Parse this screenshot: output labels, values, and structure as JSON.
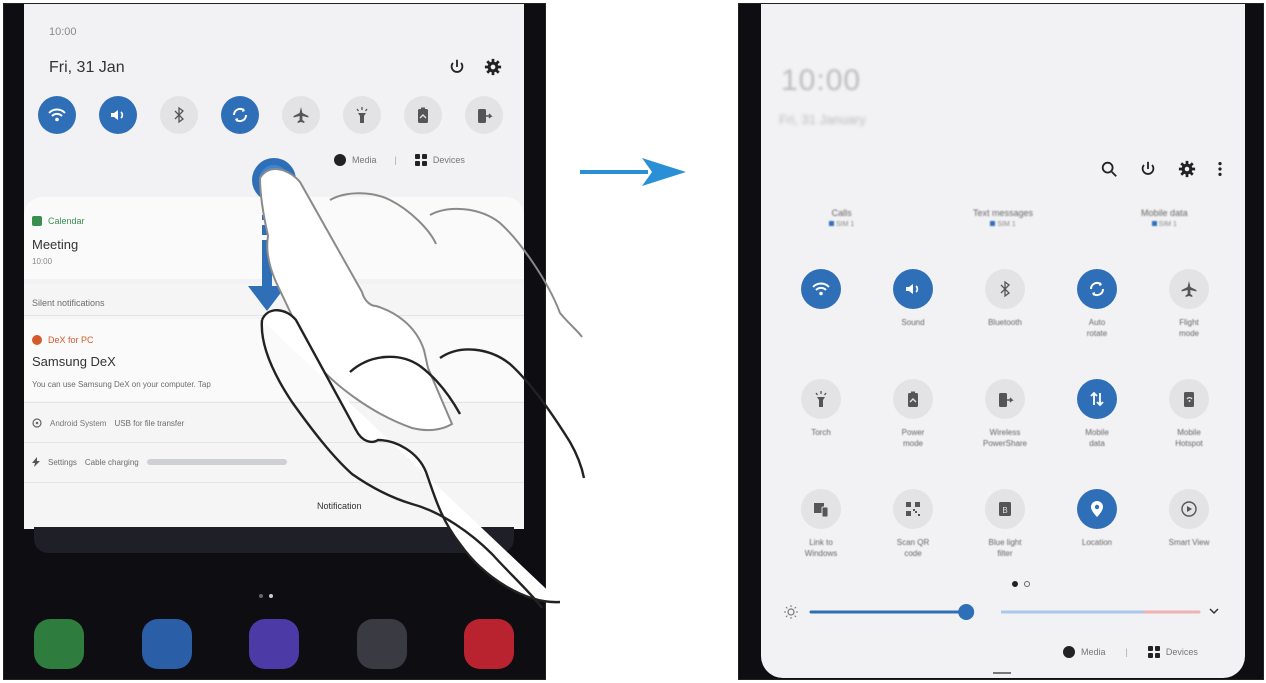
{
  "left_panel": {
    "time": "10:00",
    "date": "Fri, 31 Jan",
    "header_icons": [
      "power-icon",
      "gear-icon"
    ],
    "toggles": [
      {
        "name": "wifi",
        "on": true
      },
      {
        "name": "sound",
        "on": true
      },
      {
        "name": "bluetooth",
        "on": false
      },
      {
        "name": "auto-rotate",
        "on": true
      },
      {
        "name": "airplane",
        "on": false
      },
      {
        "name": "torch",
        "on": false
      },
      {
        "name": "power-mode",
        "on": false
      },
      {
        "name": "wireless-powershare",
        "on": false
      }
    ],
    "media_label": "Media",
    "devices_label": "Devices",
    "notification": {
      "app": "Calendar",
      "title": "Meeting",
      "time": "10:00"
    },
    "silent_label": "Silent notifications",
    "silent_card": {
      "app": "DeX for PC",
      "title": "Samsung DeX",
      "body": "You can use Samsung DeX on your computer. Tap"
    },
    "usb_row": {
      "app": "Android System",
      "text": "USB for file transfer"
    },
    "charging_row": {
      "app": "Settings",
      "text": "Cable charging"
    },
    "notification_settings": "Notification"
  },
  "right_panel": {
    "time": "10:00",
    "date": "Fri, 31 January",
    "header_icons": [
      "search-icon",
      "power-icon",
      "gear-icon",
      "more-icon"
    ],
    "sim": [
      {
        "label": "Calls",
        "value": "SIM 1"
      },
      {
        "label": "Text messages",
        "value": "SIM 1"
      },
      {
        "label": "Mobile data",
        "value": "SIM 1"
      }
    ],
    "tiles": [
      {
        "label": "",
        "icon": "wifi-icon",
        "on": true
      },
      {
        "label": "Sound",
        "icon": "sound-icon",
        "on": true
      },
      {
        "label": "Bluetooth",
        "icon": "bluetooth-icon",
        "on": false
      },
      {
        "label": "Auto\nrotate",
        "icon": "auto-rotate-icon",
        "on": true
      },
      {
        "label": "Flight\nmode",
        "icon": "airplane-icon",
        "on": false
      },
      {
        "label": "Torch",
        "icon": "torch-icon",
        "on": false
      },
      {
        "label": "Power\nmode",
        "icon": "battery-icon",
        "on": false
      },
      {
        "label": "Wireless\nPowerShare",
        "icon": "powershare-icon",
        "on": false
      },
      {
        "label": "Mobile\ndata",
        "icon": "mobile-data-icon",
        "on": true
      },
      {
        "label": "Mobile\nHotspot",
        "icon": "hotspot-icon",
        "on": false
      },
      {
        "label": "Link to\nWindows",
        "icon": "link-windows-icon",
        "on": false
      },
      {
        "label": "Scan QR\ncode",
        "icon": "qr-icon",
        "on": false
      },
      {
        "label": "Blue light\nfilter",
        "icon": "blue-light-icon",
        "on": false
      },
      {
        "label": "Location",
        "icon": "location-icon",
        "on": true
      },
      {
        "label": "Smart View",
        "icon": "smart-view-icon",
        "on": false
      }
    ],
    "brightness_level": 0.4,
    "media_label": "Media",
    "devices_label": "Devices"
  },
  "colors": {
    "accent": "#2f6fb7",
    "panel": "#f2f2f4",
    "arrow": "#2b8fd6"
  }
}
